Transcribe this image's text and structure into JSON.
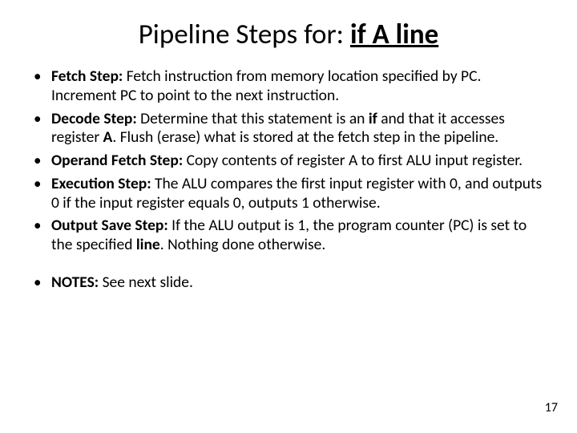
{
  "title": {
    "prefix": "Pipeline Steps for: ",
    "underlined_bold": "if A line"
  },
  "bullets": [
    {
      "label": "Fetch Step:",
      "rest": " Fetch instruction from memory location specified by PC. Increment PC to point to the next instruction."
    },
    {
      "label": "Decode Step:",
      "rest_html": " Determine that this statement is an <b>if</b> and that it accesses register <b>A</b>. Flush (erase) what is stored at the fetch step in the pipeline."
    },
    {
      "label": "Operand Fetch Step:",
      "rest": " Copy contents of register A to first ALU input register."
    },
    {
      "label": "Execution Step:",
      "rest": " The ALU compares the first input register with 0, and outputs 0 if the input register equals 0, outputs 1 otherwise."
    },
    {
      "label": "Output Save Step:",
      "rest_html": " If the ALU output is 1, the program counter (PC) is set to the specified <b>line</b>. Nothing done otherwise."
    }
  ],
  "notes": {
    "label": "NOTES:",
    "rest": " See next slide."
  },
  "page_number": "17"
}
